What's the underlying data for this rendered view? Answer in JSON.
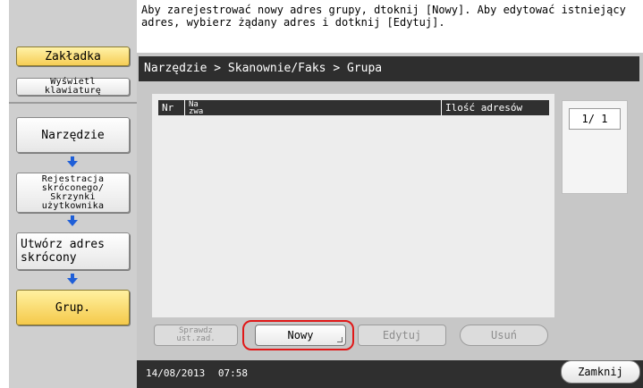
{
  "message": "Aby zarejestrować nowy adres grupy, dtoknij [Nowy]. Aby edytować istniejący\nadres, wybierz żądany adres i dotknij [Edytuj].",
  "sidebar": {
    "bookmark": "Zakładka",
    "show_keyboard": "Wyświetl\nklawiaturę",
    "tool": "Narzędzie",
    "register": "Rejestracja\nskróconego/\nSkrzynki\nużytkownika",
    "create_address": "Utwórz adres\nskrócony",
    "group": "Grup."
  },
  "breadcrumb": "Narzędzie > Skanownie/Faks > Grupa",
  "table": {
    "headers": [
      "Nr",
      "Na\nzwa",
      "Ilość adresów"
    ],
    "rows": []
  },
  "page_indicator": "1/  1",
  "buttons": {
    "check_settings": "Sprawdz\nust.zad.",
    "new": "Nowy",
    "edit": "Edytuj",
    "delete": "Usuń",
    "close": "Zamknij"
  },
  "footer": {
    "date": "14/08/2013",
    "time": "07:58"
  },
  "colors": {
    "sidebar_highlight": "#f5c94a",
    "header_bar": "#2e2e2e",
    "callout": "#e01818",
    "arrow": "#1f5fd8"
  }
}
